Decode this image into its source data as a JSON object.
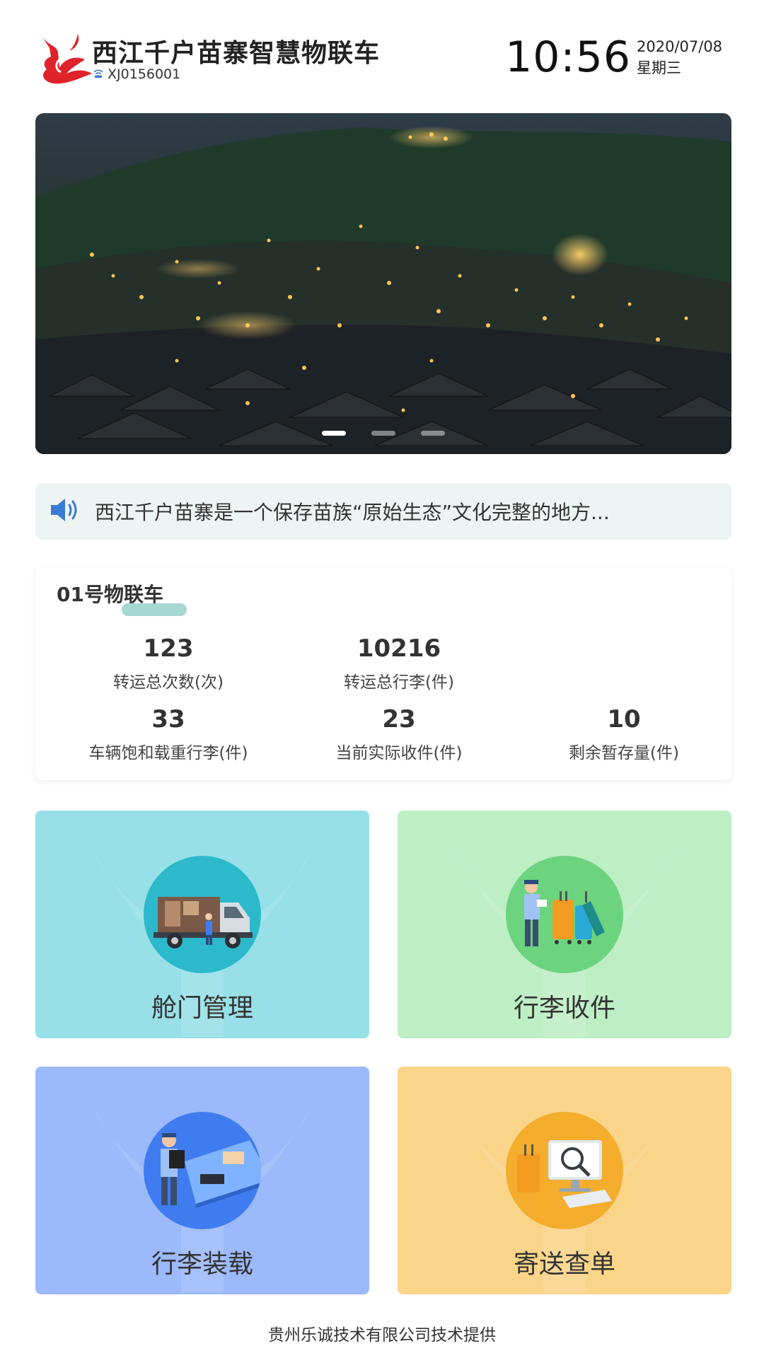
{
  "header": {
    "title": "西江千户苗寨智慧物联车",
    "device_id": "XJ0156001",
    "time": "10:56",
    "date": "2020/07/08",
    "weekday": "星期三"
  },
  "banner": {
    "slide_count": 3,
    "active_slide": 1
  },
  "notice": {
    "text": "西江千户苗寨是一个保存苗族“原始生态”文化完整的地方..."
  },
  "stats": {
    "title": "01号物联车",
    "items": [
      {
        "value": "123",
        "label": "转运总次数(次)"
      },
      {
        "value": "10216",
        "label": "转运总行李(件)"
      },
      {
        "value": "33",
        "label": "车辆饱和载重行李(件)"
      },
      {
        "value": "23",
        "label": "当前实际收件(件)"
      },
      {
        "value": "10",
        "label": "剩余暂存量(件)"
      }
    ]
  },
  "tiles": [
    {
      "label": "舱门管理",
      "bg": "#98e0e8",
      "circle": "#2db9cc",
      "icon": "truck-icon"
    },
    {
      "label": "行李收件",
      "bg": "#bdeec4",
      "circle": "#6cd37f",
      "icon": "luggage-receive-icon"
    },
    {
      "label": "行李装载",
      "bg": "#9bb9fb",
      "circle": "#3f7cf0",
      "icon": "luggage-loading-icon"
    },
    {
      "label": "寄送查单",
      "bg": "#fad488",
      "circle": "#f4ad2c",
      "icon": "order-search-icon"
    }
  ],
  "footer": {
    "text": "贵州乐诚技术有限公司技术提供"
  },
  "colors": {
    "logo": "#e0222a",
    "wifi_icon": "#3a7bd5",
    "speaker_icon": "#3a7bd5",
    "notice_bg": "#eef4f3",
    "stats_accent": "#a6d8d2"
  }
}
